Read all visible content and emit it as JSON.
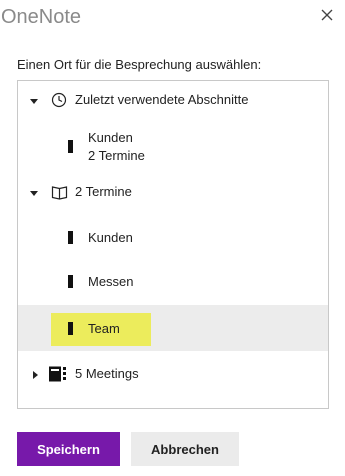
{
  "dialog": {
    "title": "OneNote",
    "prompt": "Einen Ort für die Besprechung auswählen:"
  },
  "tree": {
    "recent": {
      "label": "Zuletzt verwendete Abschnitte",
      "icon": "clock-icon",
      "expanded": true,
      "items": [
        {
          "label": "Kunden",
          "sublabel": "2 Termine"
        }
      ]
    },
    "notebook": {
      "label": "2 Termine",
      "icon": "book-icon",
      "expanded": true,
      "sections": [
        {
          "label": "Kunden"
        },
        {
          "label": "Messen"
        },
        {
          "label": "Team",
          "selected": true
        }
      ]
    },
    "notebook2": {
      "label": "5 Meetings",
      "icon": "notebook-icon",
      "expanded": false
    }
  },
  "buttons": {
    "save": "Speichern",
    "cancel": "Abbrechen"
  },
  "colors": {
    "accent": "#7719aa",
    "highlight": "#ecec5c",
    "selected_row": "#ececec"
  }
}
